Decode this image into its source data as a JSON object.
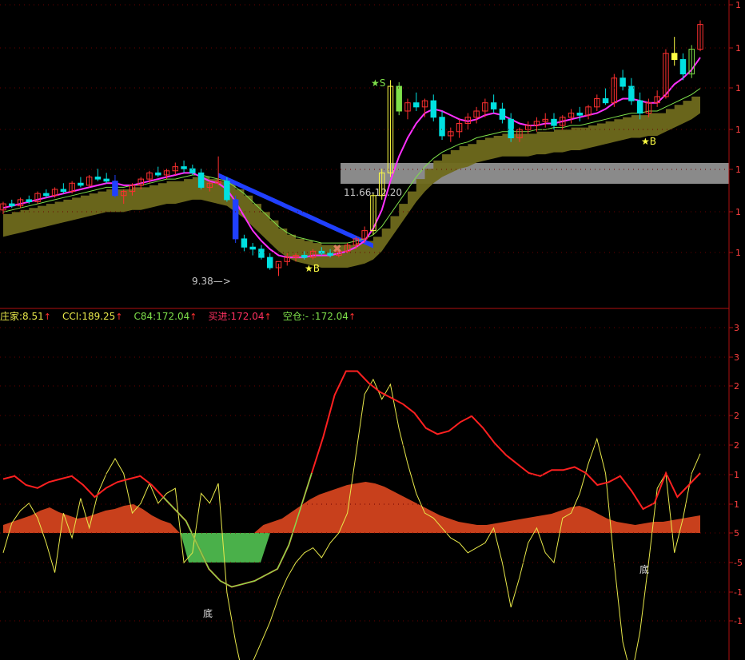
{
  "colors": {
    "background": "#000000",
    "axis": "#b01010",
    "grid": "#6a0000",
    "up_candle": "#ff3030",
    "down_candle": "#00e0e0",
    "yellow": "#ffff44",
    "green_bar": "#7ee04a",
    "blue_band": "#2040ff",
    "olive_band": "#6f6a1c",
    "gray_box": "#8a8a8a",
    "magenta": "#ff30ff",
    "red_line": "#ff2020",
    "yellow_line": "#e8e84a",
    "orange_fill": "#c8401c",
    "green_fill": "#4ab04a"
  },
  "top_panel": {
    "axis_labels": [
      "1",
      "1",
      "1",
      "1",
      "1",
      "1",
      "1"
    ],
    "price_range_label": "11.66-12.20",
    "low_label": "9.38",
    "signals": [
      {
        "name": "star-s",
        "text": "★S"
      },
      {
        "name": "star-b-1",
        "text": "★B"
      },
      {
        "name": "star-b-2",
        "text": "★B"
      }
    ],
    "sell_icon_glyph": "✖"
  },
  "bottom_panel": {
    "axis_labels": [
      "3",
      "3",
      "2",
      "2",
      "2",
      "1",
      "1",
      "5",
      "-5",
      "-1",
      "-1"
    ],
    "legend": [
      {
        "label": "庄家:8.51",
        "color": "#e8e84a"
      },
      {
        "label": "CCI:189.25",
        "color": "#e8e84a"
      },
      {
        "label": "C84:172.04",
        "color": "#7ee04a"
      },
      {
        "label": "买进:172.04",
        "color": "#ff3060"
      },
      {
        "label": "空仓:- :172.04",
        "color": "#7ee04a"
      }
    ],
    "arrow": "↑",
    "bottom_labels": [
      "底",
      "底"
    ]
  },
  "chart_data": {
    "type": "candlestick-indicator",
    "title": "",
    "candles": [
      [
        14.2,
        14.6,
        14.0,
        14.5
      ],
      [
        14.5,
        14.7,
        14.3,
        14.4
      ],
      [
        14.4,
        14.8,
        14.3,
        14.7
      ],
      [
        14.7,
        14.9,
        14.5,
        14.6
      ],
      [
        14.6,
        15.1,
        14.5,
        15.0
      ],
      [
        15.0,
        15.2,
        14.8,
        14.9
      ],
      [
        14.9,
        15.3,
        14.8,
        15.2
      ],
      [
        15.2,
        15.5,
        15.0,
        15.1
      ],
      [
        15.1,
        15.6,
        15.0,
        15.5
      ],
      [
        15.5,
        15.8,
        15.3,
        15.4
      ],
      [
        15.4,
        15.9,
        15.3,
        15.8
      ],
      [
        15.8,
        16.2,
        15.6,
        15.7
      ],
      [
        15.7,
        16.0,
        15.5,
        15.6
      ],
      [
        15.6,
        15.9,
        14.8,
        14.9
      ],
      [
        14.9,
        15.2,
        14.5,
        15.1
      ],
      [
        15.1,
        15.5,
        14.9,
        15.4
      ],
      [
        15.4,
        15.8,
        15.2,
        15.7
      ],
      [
        15.7,
        16.1,
        15.5,
        16.0
      ],
      [
        16.0,
        16.3,
        15.8,
        15.9
      ],
      [
        15.9,
        16.2,
        15.7,
        16.1
      ],
      [
        16.1,
        16.5,
        15.9,
        16.3
      ],
      [
        16.3,
        16.6,
        16.0,
        16.2
      ],
      [
        16.2,
        16.4,
        15.9,
        16.0
      ],
      [
        16.0,
        16.2,
        15.2,
        15.3
      ],
      [
        15.3,
        15.6,
        15.1,
        15.5
      ],
      [
        15.5,
        16.8,
        15.4,
        15.6
      ],
      [
        15.6,
        15.8,
        14.6,
        14.7
      ],
      [
        14.7,
        14.9,
        12.6,
        12.8
      ],
      [
        12.8,
        13.0,
        12.2,
        12.4
      ],
      [
        12.4,
        12.6,
        12.0,
        12.3
      ],
      [
        12.3,
        12.5,
        11.8,
        11.9
      ],
      [
        11.9,
        12.1,
        11.3,
        11.4
      ],
      [
        11.4,
        11.6,
        11.0,
        11.7
      ],
      [
        11.7,
        12.1,
        11.5,
        11.9
      ],
      [
        11.9,
        12.1,
        11.7,
        12.0
      ],
      [
        12.0,
        12.2,
        11.8,
        11.9
      ],
      [
        11.9,
        12.3,
        11.8,
        12.2
      ],
      [
        12.2,
        12.4,
        12.0,
        12.1
      ],
      [
        12.1,
        12.3,
        11.9,
        12.0
      ],
      [
        12.0,
        12.3,
        11.9,
        12.2
      ],
      [
        12.2,
        12.6,
        12.1,
        12.5
      ],
      [
        12.5,
        12.9,
        12.3,
        12.8
      ],
      [
        12.8,
        13.4,
        12.6,
        13.2
      ],
      [
        13.2,
        15.0,
        13.0,
        14.9
      ],
      [
        14.9,
        16.2,
        14.7,
        16.0
      ],
      [
        16.0,
        20.5,
        15.8,
        20.2
      ],
      [
        20.2,
        20.4,
        18.8,
        19.0
      ],
      [
        19.0,
        19.6,
        18.6,
        19.4
      ],
      [
        19.4,
        19.9,
        19.0,
        19.2
      ],
      [
        19.2,
        19.6,
        18.7,
        19.5
      ],
      [
        19.5,
        19.8,
        18.5,
        18.7
      ],
      [
        18.7,
        19.0,
        17.6,
        17.8
      ],
      [
        17.8,
        18.2,
        17.5,
        18.0
      ],
      [
        18.0,
        18.6,
        17.7,
        18.4
      ],
      [
        18.4,
        18.9,
        18.1,
        18.7
      ],
      [
        18.7,
        19.2,
        18.4,
        19.0
      ],
      [
        19.0,
        19.6,
        18.7,
        19.4
      ],
      [
        19.4,
        19.8,
        18.9,
        19.1
      ],
      [
        19.1,
        19.4,
        18.4,
        18.6
      ],
      [
        18.6,
        18.9,
        17.5,
        17.7
      ],
      [
        17.7,
        18.2,
        17.5,
        18.1
      ],
      [
        18.1,
        18.5,
        17.9,
        18.3
      ],
      [
        18.3,
        18.7,
        18.0,
        18.5
      ],
      [
        18.5,
        18.9,
        18.2,
        18.6
      ],
      [
        18.6,
        18.9,
        18.1,
        18.3
      ],
      [
        18.3,
        18.8,
        18.1,
        18.7
      ],
      [
        18.7,
        19.1,
        18.4,
        18.9
      ],
      [
        18.9,
        19.2,
        18.5,
        18.8
      ],
      [
        18.8,
        19.3,
        18.6,
        19.2
      ],
      [
        19.2,
        19.8,
        19.0,
        19.6
      ],
      [
        19.6,
        20.1,
        19.3,
        19.4
      ],
      [
        19.4,
        20.8,
        19.2,
        20.6
      ],
      [
        20.6,
        21.0,
        20.0,
        20.2
      ],
      [
        20.2,
        20.6,
        19.3,
        19.5
      ],
      [
        19.5,
        19.9,
        18.6,
        18.9
      ],
      [
        18.9,
        19.6,
        18.7,
        19.4
      ],
      [
        19.4,
        20.0,
        19.2,
        19.7
      ],
      [
        19.7,
        22.0,
        19.6,
        21.8
      ],
      [
        21.8,
        22.6,
        21.2,
        21.5
      ],
      [
        21.5,
        21.8,
        20.5,
        20.8
      ],
      [
        20.8,
        22.2,
        20.6,
        22.0
      ],
      [
        22.0,
        23.4,
        21.9,
        23.2
      ]
    ],
    "ma_short": [
      14.3,
      14.4,
      14.5,
      14.6,
      14.7,
      14.8,
      14.9,
      15.0,
      15.1,
      15.2,
      15.3,
      15.4,
      15.5,
      15.5,
      15.4,
      15.4,
      15.5,
      15.6,
      15.7,
      15.8,
      15.9,
      16.0,
      16.0,
      15.8,
      15.6,
      15.5,
      15.2,
      14.6,
      13.9,
      13.2,
      12.7,
      12.3,
      12.0,
      11.9,
      11.9,
      11.9,
      12.0,
      12.0,
      12.0,
      12.1,
      12.2,
      12.4,
      12.7,
      13.3,
      14.2,
      15.6,
      16.8,
      17.7,
      18.4,
      18.9,
      19.1,
      19.0,
      18.8,
      18.6,
      18.5,
      18.6,
      18.8,
      18.9,
      18.8,
      18.6,
      18.4,
      18.3,
      18.3,
      18.4,
      18.4,
      18.5,
      18.6,
      18.7,
      18.8,
      18.9,
      19.1,
      19.4,
      19.6,
      19.6,
      19.5,
      19.4,
      19.4,
      19.8,
      20.3,
      20.6,
      21.0,
      21.6
    ],
    "ma_long": [
      14.1,
      14.2,
      14.3,
      14.4,
      14.5,
      14.6,
      14.7,
      14.8,
      14.9,
      15.0,
      15.1,
      15.2,
      15.3,
      15.3,
      15.3,
      15.4,
      15.4,
      15.5,
      15.6,
      15.7,
      15.7,
      15.8,
      15.9,
      15.9,
      15.8,
      15.7,
      15.6,
      15.3,
      15.0,
      14.6,
      14.2,
      13.8,
      13.4,
      13.1,
      12.9,
      12.8,
      12.7,
      12.6,
      12.6,
      12.6,
      12.6,
      12.7,
      12.8,
      13.0,
      13.4,
      14.0,
      14.6,
      15.2,
      15.8,
      16.3,
      16.7,
      17.0,
      17.2,
      17.4,
      17.5,
      17.7,
      17.8,
      17.9,
      18.0,
      18.0,
      18.0,
      18.0,
      18.1,
      18.1,
      18.2,
      18.2,
      18.3,
      18.3,
      18.4,
      18.5,
      18.6,
      18.7,
      18.8,
      18.9,
      18.9,
      19.0,
      19.0,
      19.2,
      19.4,
      19.6,
      19.8,
      20.1
    ],
    "cci": [
      -40,
      20,
      45,
      60,
      30,
      -20,
      -80,
      40,
      -10,
      70,
      10,
      80,
      120,
      150,
      120,
      40,
      60,
      100,
      60,
      80,
      90,
      -60,
      -40,
      80,
      60,
      100,
      -120,
      -220,
      -300,
      -260,
      -220,
      -180,
      -130,
      -90,
      -60,
      -40,
      -30,
      -50,
      -20,
      0,
      40,
      160,
      280,
      310,
      270,
      300,
      210,
      140,
      80,
      40,
      30,
      10,
      -10,
      -20,
      -40,
      -30,
      -20,
      10,
      -60,
      -150,
      -90,
      -20,
      10,
      -40,
      -60,
      30,
      40,
      80,
      140,
      190,
      120,
      -60,
      -220,
      -290,
      -200,
      -60,
      90,
      120,
      -40,
      30,
      120,
      160
    ],
    "cci_line": [
      90,
      95,
      80,
      75,
      85,
      90,
      95,
      80,
      60,
      75,
      85,
      90,
      95,
      80,
      60,
      40,
      20,
      -20,
      -60,
      -80,
      -90,
      -85,
      -80,
      -70,
      -60,
      -20,
      40,
      100,
      160,
      230,
      270,
      270,
      250,
      235,
      225,
      215,
      200,
      175,
      165,
      170,
      185,
      195,
      175,
      150,
      130,
      115,
      100,
      95,
      105,
      105,
      110,
      100,
      80,
      85,
      95,
      70,
      40,
      50,
      100,
      60,
      80,
      100
    ],
    "main_fill": [
      10,
      14,
      18,
      22,
      28,
      32,
      26,
      22,
      18,
      20,
      24,
      28,
      30,
      34,
      36,
      30,
      22,
      16,
      12,
      8,
      6,
      4,
      4,
      6,
      8,
      6,
      4,
      6,
      10,
      14,
      18,
      26,
      34,
      42,
      48,
      52,
      56,
      60,
      62,
      64,
      62,
      58,
      52,
      46,
      40,
      34,
      28,
      22,
      18,
      14,
      12,
      10,
      10,
      12,
      14,
      16,
      18,
      20,
      22,
      24,
      28,
      32,
      34,
      30,
      24,
      18,
      14,
      12,
      10,
      12,
      14,
      14,
      16,
      18,
      20,
      22
    ]
  }
}
